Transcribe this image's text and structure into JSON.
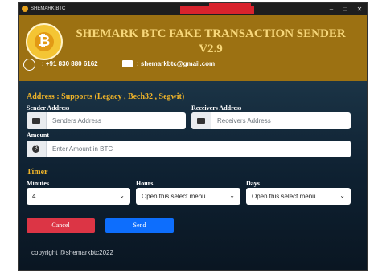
{
  "window": {
    "title": "SHEMARK BTC"
  },
  "header": {
    "title_line1": "SHEMARK BTC FAKE TRANSACTION SENDER",
    "title_line2": "V2.9",
    "phone": ": +91 830 880 6162",
    "email": ": shemarkbtc@gmail.com"
  },
  "address": {
    "section_title": "Address : Supports (Legacy , Bech32 , Segwit)",
    "sender_label": "Sender Address",
    "sender_placeholder": "Senders Address",
    "receiver_label": "Receivers Address",
    "receiver_placeholder": "Receivers Address",
    "amount_label": "Amount",
    "amount_placeholder": "Enter Amount in BTC"
  },
  "timer": {
    "section_title": "Timer",
    "minutes_label": "Minutes",
    "minutes_value": "4",
    "hours_label": "Hours",
    "hours_value": "Open this select menu",
    "days_label": "Days",
    "days_value": "Open this select menu"
  },
  "actions": {
    "cancel_label": "Cancel",
    "send_label": "Send"
  },
  "footer": {
    "copyright": "copyright @shemarkbtc2022"
  },
  "colors": {
    "header_bg": "#9c7112",
    "accent_gold": "#f0b429",
    "cancel": "#dc3545",
    "send": "#0d6efd"
  },
  "icons": [
    "bitcoin-logo-icon",
    "whatsapp-icon",
    "mail-icon",
    "id-card-icon",
    "bitcoin-coin-icon",
    "chevron-down-icon"
  ]
}
